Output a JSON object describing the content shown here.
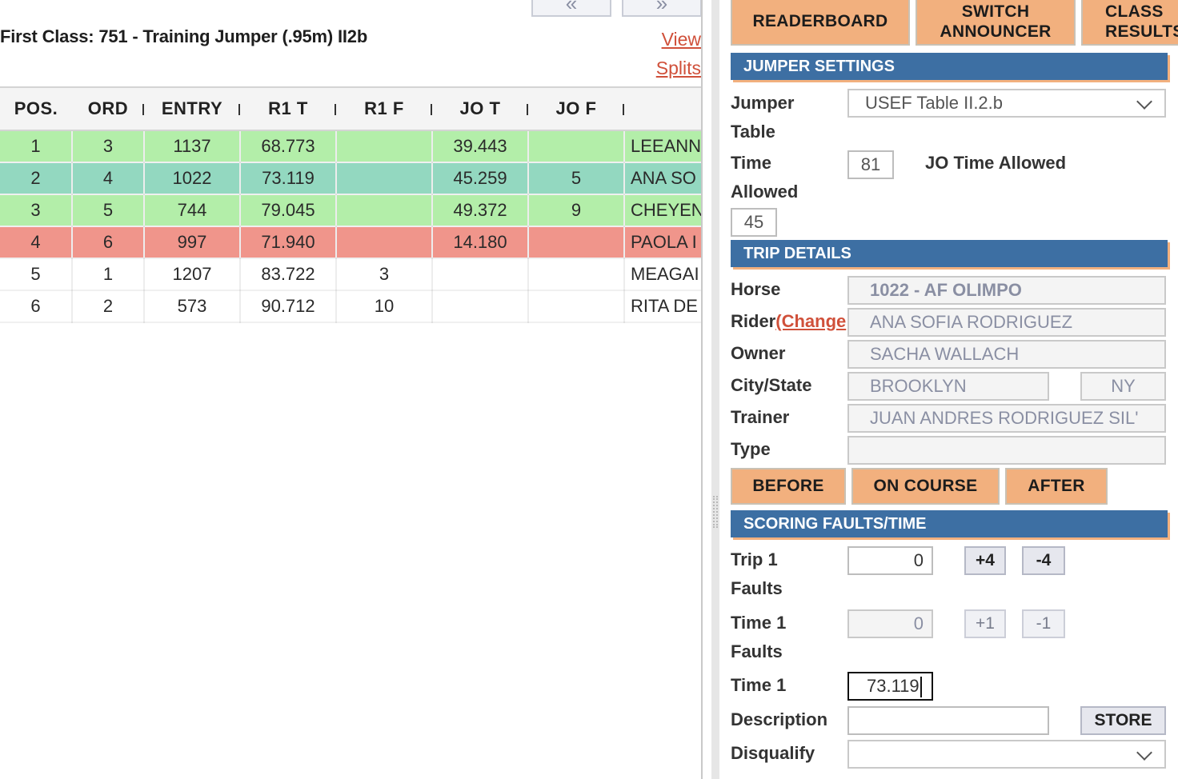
{
  "nav": {
    "prev": "«",
    "next": "»"
  },
  "class_title": "First Class: 751 - Training Jumper (.95m) II2b",
  "view_splits": [
    "View",
    "Splits"
  ],
  "table": {
    "headers": [
      "POS.",
      "ORD",
      "ENTRY",
      "R1 T",
      "R1 F",
      "JO T",
      "JO F",
      ""
    ],
    "rows": [
      {
        "cells": [
          "1",
          "3",
          "1137",
          "68.773",
          "",
          "39.443",
          "",
          "LEEANN"
        ],
        "status": "green"
      },
      {
        "cells": [
          "2",
          "4",
          "1022",
          "73.119",
          "",
          "45.259",
          "5",
          "ANA SO"
        ],
        "status": "teal"
      },
      {
        "cells": [
          "3",
          "5",
          "744",
          "79.045",
          "",
          "49.372",
          "9",
          "CHEYEN"
        ],
        "status": "green"
      },
      {
        "cells": [
          "4",
          "6",
          "997",
          "71.940",
          "",
          "14.180",
          "",
          "PAOLA I"
        ],
        "status": "red"
      },
      {
        "cells": [
          "5",
          "1",
          "1207",
          "83.722",
          "3",
          "",
          "",
          "MEAGAI"
        ],
        "status": "white"
      },
      {
        "cells": [
          "6",
          "2",
          "573",
          "90.712",
          "10",
          "",
          "",
          "RITA DE"
        ],
        "status": "white"
      }
    ]
  },
  "top_buttons": {
    "readerboard": "READERBOARD",
    "switch_announcer": [
      "SWITCH",
      "ANNOUNCER"
    ],
    "class_results": [
      "CLASS",
      "RESULTS"
    ]
  },
  "jumper_settings": {
    "header": "JUMPER SETTINGS",
    "jumper_table_label": [
      "Jumper",
      "Table"
    ],
    "jumper_table_value": "USEF Table II.2.b",
    "time_allowed_label": [
      "Time",
      "Allowed"
    ],
    "time_allowed_value": "81",
    "jo_time_allowed_label": "JO Time Allowed",
    "jo_time_allowed_value": "45"
  },
  "trip_details": {
    "header": "TRIP DETAILS",
    "horse_label": "Horse",
    "horse_value": "1022 - AF OLIMPO",
    "rider_label": "Rider",
    "rider_change": "(Change",
    "rider_value": "ANA SOFIA RODRIGUEZ",
    "owner_label": "Owner",
    "owner_value": "SACHA  WALLACH",
    "city_state_label": "City/State",
    "city_value": "BROOKLYN",
    "state_value": "NY",
    "trainer_label": "Trainer",
    "trainer_value": "JUAN ANDRES RODRIGUEZ SIL'",
    "type_label": "Type",
    "type_value": "",
    "before": "BEFORE",
    "on_course": "ON COURSE",
    "after": "AFTER"
  },
  "scoring": {
    "header": "SCORING FAULTS/TIME",
    "trip1_faults_label": [
      "Trip 1",
      "Faults"
    ],
    "trip1_faults_value": "0",
    "plus4": "+4",
    "minus4": "-4",
    "time1_faults_label": [
      "Time 1",
      "Faults"
    ],
    "time1_faults_value": "0",
    "plus1": "+1",
    "minus1": "-1",
    "time1_label": "Time 1",
    "time1_value": "73.119",
    "description_label": "Description",
    "description_value": "",
    "store": "STORE",
    "disqualify_label": "Disqualify",
    "disqualify_value": ""
  }
}
